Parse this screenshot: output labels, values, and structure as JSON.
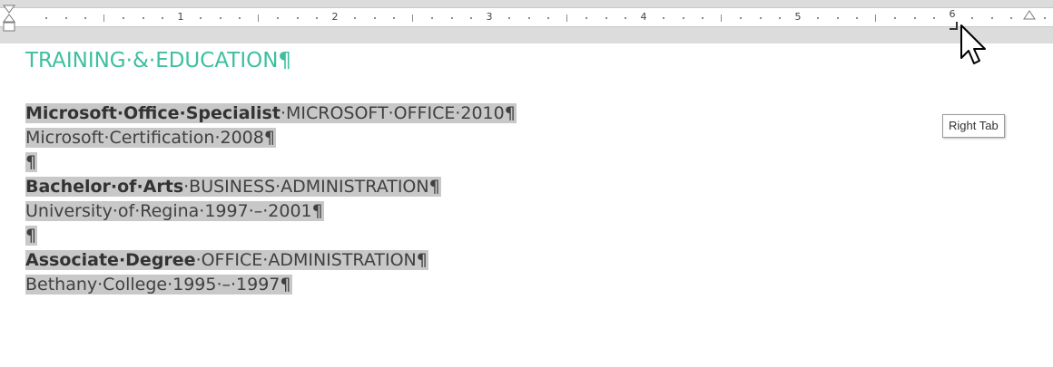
{
  "ruler": {
    "numbers": [
      "1",
      "2",
      "3",
      "4",
      "5",
      "6"
    ]
  },
  "document": {
    "heading": "TRAINING·&·EDUCATION¶",
    "entries": [
      {
        "bold": "Microsoft·Office·Specialist",
        "rest": "·MICROSOFT·OFFICE·2010¶"
      },
      {
        "bold": "",
        "rest": "Microsoft·Certification·2008¶"
      },
      {
        "bold": "",
        "rest": "¶"
      },
      {
        "bold": "Bachelor·of·Arts",
        "rest": "·BUSINESS·ADMINISTRATION¶"
      },
      {
        "bold": "",
        "rest": "University·of·Regina·1997·–·2001¶"
      },
      {
        "bold": "",
        "rest": "¶"
      },
      {
        "bold": "Associate·Degree",
        "rest": "·OFFICE·ADMINISTRATION¶"
      },
      {
        "bold": "",
        "rest": "Bethany·College·1995·–·1997¶"
      }
    ]
  },
  "tooltip": {
    "text": "Right Tab"
  },
  "colors": {
    "heading": "#3dbfa0",
    "selection": "#c8c8c8",
    "ruler_background": "#dcdcdc"
  },
  "icons": {
    "cursor": "arrow-cursor-icon",
    "tab_stop": "right-tab-stop-icon",
    "indent": "hanging-indent-marker-icon"
  }
}
